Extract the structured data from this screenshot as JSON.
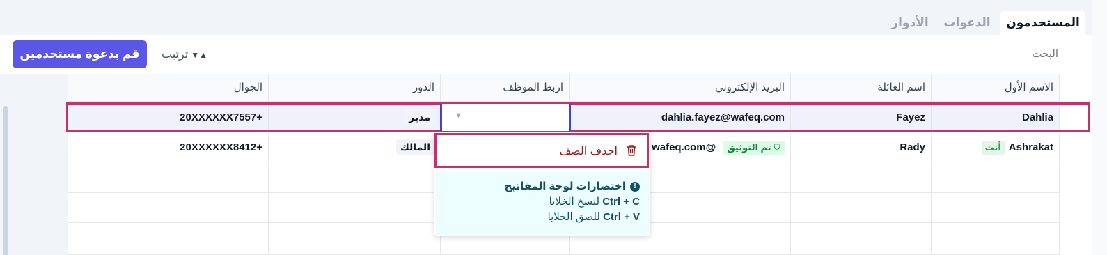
{
  "tabs": [
    {
      "label": "المستخدمون",
      "active": true
    },
    {
      "label": "الدعوات",
      "active": false
    },
    {
      "label": "الأدوار",
      "active": false
    }
  ],
  "toolbar": {
    "search_placeholder": "البحث",
    "sort_label": "ترتيب",
    "sort_icon": "sort-arrows",
    "invite_label": "قم بدعوة مستخدمين",
    "invite_color": "#5b56e8"
  },
  "table": {
    "headers": {
      "first_name": "الاسم الأول",
      "last_name": "اسم العائلة",
      "email": "البريد الإلكتروني",
      "link_employee": "اربط الموظف",
      "role": "الدور",
      "mobile": "الجوال"
    },
    "rows": [
      {
        "first_name": "Dahlia",
        "last_name": "Fayez",
        "email": "dahlia.fayez@wafeq.com",
        "link_employee": "",
        "role": "مدير",
        "mobile": "+20XXXXXX7557",
        "selected": true
      },
      {
        "first_name": "Ashrakat",
        "you_badge": "أنت",
        "last_name": "Rady",
        "email": "@wafeq.com",
        "verified_badge": "تم التوثيق",
        "role": "المالك",
        "mobile": "+20XXXXXX8412",
        "selected": false
      }
    ]
  },
  "context_menu": {
    "delete_label": "احذف الصف",
    "delete_icon": "trash-icon",
    "shortcuts_title": "اختصارات لوحة المفاتيح",
    "copy_keys": "Ctrl + C",
    "copy_label": "لنسخ الخلايا",
    "paste_keys": "Ctrl + V",
    "paste_label": "للصق الخلايا"
  },
  "colors": {
    "selection_border": "#c0346a",
    "focus_border": "#4b3fd0",
    "delete_text": "#991b1b",
    "verified_green": "#15803d"
  }
}
